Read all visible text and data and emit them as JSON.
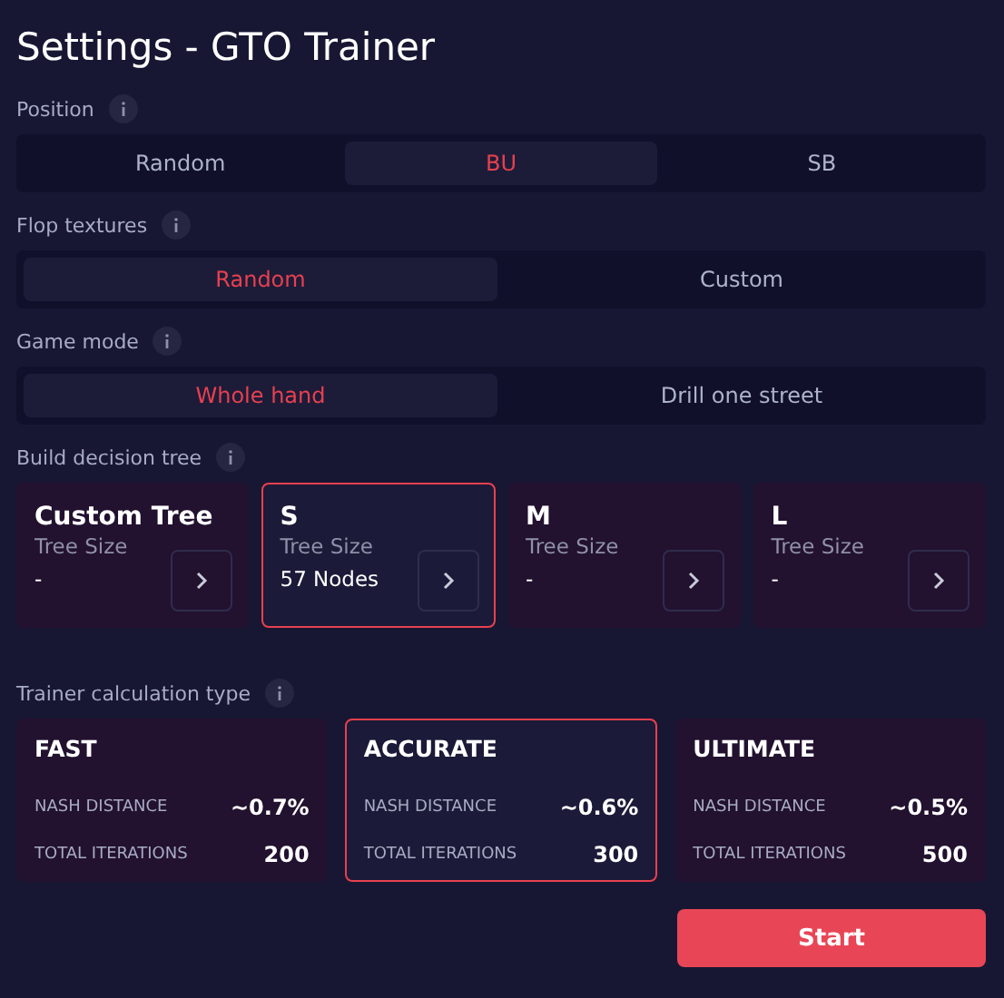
{
  "title": "Settings - GTO Trainer",
  "position": {
    "label": "Position",
    "options": [
      {
        "label": "Random",
        "selected": false
      },
      {
        "label": "BU",
        "selected": true
      },
      {
        "label": "SB",
        "selected": false
      }
    ]
  },
  "flop_textures": {
    "label": "Flop textures",
    "options": [
      {
        "label": "Random",
        "selected": true
      },
      {
        "label": "Custom",
        "selected": false
      }
    ]
  },
  "game_mode": {
    "label": "Game mode",
    "options": [
      {
        "label": "Whole hand",
        "selected": true
      },
      {
        "label": "Drill one street",
        "selected": false
      }
    ]
  },
  "decision_tree": {
    "label": "Build decision tree",
    "cards": [
      {
        "name": "Custom Tree",
        "caption": "Tree Size",
        "value": "-",
        "selected": false
      },
      {
        "name": "S",
        "caption": "Tree Size",
        "value": "57 Nodes",
        "selected": true
      },
      {
        "name": "M",
        "caption": "Tree Size",
        "value": "-",
        "selected": false
      },
      {
        "name": "L",
        "caption": "Tree Size",
        "value": "-",
        "selected": false
      }
    ]
  },
  "calculation_type": {
    "label": "Trainer calculation type",
    "cards": [
      {
        "name": "FAST",
        "rows": [
          {
            "label": "NASH DISTANCE",
            "value": "~0.7%"
          },
          {
            "label": "TOTAL ITERATIONS",
            "value": "200"
          }
        ],
        "selected": false
      },
      {
        "name": "ACCURATE",
        "rows": [
          {
            "label": "NASH DISTANCE",
            "value": "~0.6%"
          },
          {
            "label": "TOTAL ITERATIONS",
            "value": "300"
          }
        ],
        "selected": true
      },
      {
        "name": "ULTIMATE",
        "rows": [
          {
            "label": "NASH DISTANCE",
            "value": "~0.5%"
          },
          {
            "label": "TOTAL ITERATIONS",
            "value": "500"
          }
        ],
        "selected": false
      }
    ]
  },
  "start_button": "Start"
}
